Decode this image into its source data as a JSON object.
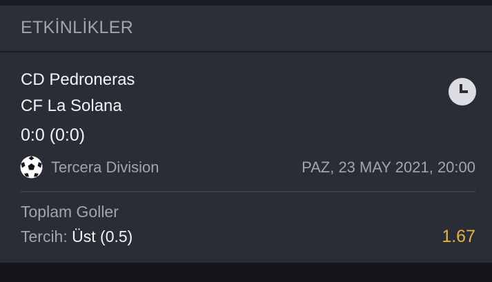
{
  "section": {
    "title": "ETKİNLİKLER"
  },
  "event": {
    "home_team": "CD Pedroneras",
    "away_team": "CF La Solana",
    "score": "0:0 (0:0)",
    "league": "Tercera Division",
    "datetime": "PAZ, 23 MAY 2021, 20:00",
    "status_icon": "clock-icon",
    "sport_icon": "soccer-ball-icon"
  },
  "bet": {
    "market": "Toplam Goller",
    "selection_label": "Tercih:",
    "selection_value": "Üst (0.5)",
    "odds": "1.67"
  },
  "colors": {
    "background": "#15161c",
    "header": "#2d2f38",
    "card": "#2b2d36",
    "primary_text": "#f2f3f5",
    "secondary_text": "#a3a5ad",
    "odds": "#e3b43c"
  }
}
